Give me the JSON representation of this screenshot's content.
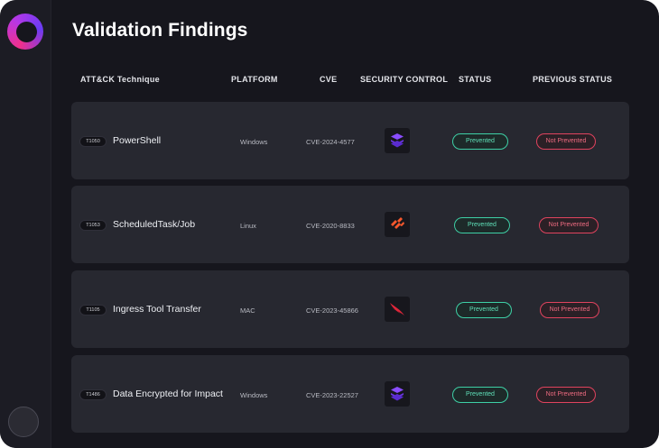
{
  "page": {
    "title": "Validation Findings"
  },
  "columns": {
    "technique": "ATT&CK Technique",
    "platform": "PLATFORM",
    "cve": "CVE",
    "security_control": "SECURITY CONTROL",
    "status": "STATUS",
    "previous_status": "PREVIOUS STATUS"
  },
  "rows": [
    {
      "id": "T1050",
      "name": "PowerShell",
      "platform": "Windows",
      "cve": "CVE-2024-4577",
      "control_icon": "purple-stack-logo-icon",
      "status": "Prevented",
      "previous_status": "Not Prevented"
    },
    {
      "id": "T1053",
      "name": "ScheduledTask/Job",
      "platform": "Linux",
      "cve": "CVE-2020-8833",
      "control_icon": "orange-stripes-logo-icon",
      "status": "Prevented",
      "previous_status": "Not Prevented"
    },
    {
      "id": "T1105",
      "name": "Ingress Tool Transfer",
      "platform": "MAC",
      "cve": "CVE-2023-45866",
      "control_icon": "red-falcon-logo-icon",
      "status": "Prevented",
      "previous_status": "Not Prevented"
    },
    {
      "id": "T1486",
      "name": "Data Encrypted for Impact",
      "platform": "Windows",
      "cve": "CVE-2023-22527",
      "control_icon": "purple-stack-logo-icon",
      "status": "Prevented",
      "previous_status": "Not Prevented"
    }
  ],
  "colors": {
    "prevented": "#3ed0a6",
    "not_prevented": "#e0435e",
    "row_bg": "#272830",
    "window_bg": "#16161d"
  }
}
